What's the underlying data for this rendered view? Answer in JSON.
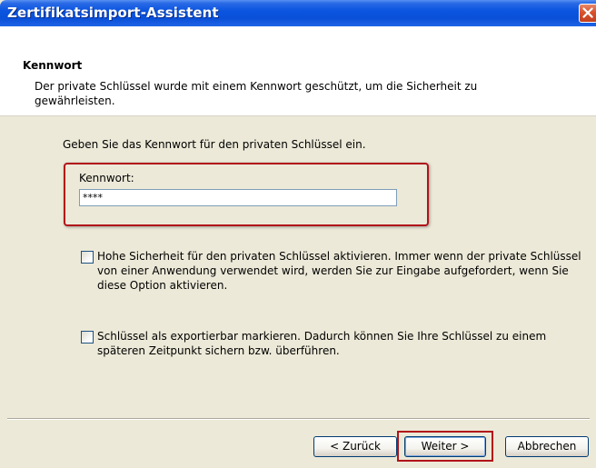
{
  "window": {
    "title": "Zertifikatsimport-Assistent",
    "close_icon": "close-icon"
  },
  "header": {
    "title": "Kennwort",
    "description": "Der private Schlüssel wurde mit einem Kennwort geschützt, um die Sicherheit zu gewährleisten."
  },
  "main": {
    "prompt": "Geben Sie das Kennwort für den privaten Schlüssel ein.",
    "password_label": "Kennwort:",
    "password_value": "****",
    "options": [
      {
        "label": "Hohe Sicherheit für den privaten Schlüssel aktivieren. Immer wenn der private Schlüssel von einer Anwendung verwendet wird, werden Sie zur Eingabe aufgefordert, wenn Sie diese Option aktivieren.",
        "checked": false
      },
      {
        "label": "Schlüssel als exportierbar markieren. Dadurch können Sie Ihre Schlüssel zu einem späteren Zeitpunkt sichern bzw. überführen.",
        "checked": false
      }
    ]
  },
  "footer": {
    "back_label": "< Zurück",
    "next_label": "Weiter >",
    "cancel_label": "Abbrechen"
  },
  "colors": {
    "titlebar": "#0b55e0",
    "highlight": "#b1121a",
    "dialog_bg": "#ece9d8"
  }
}
